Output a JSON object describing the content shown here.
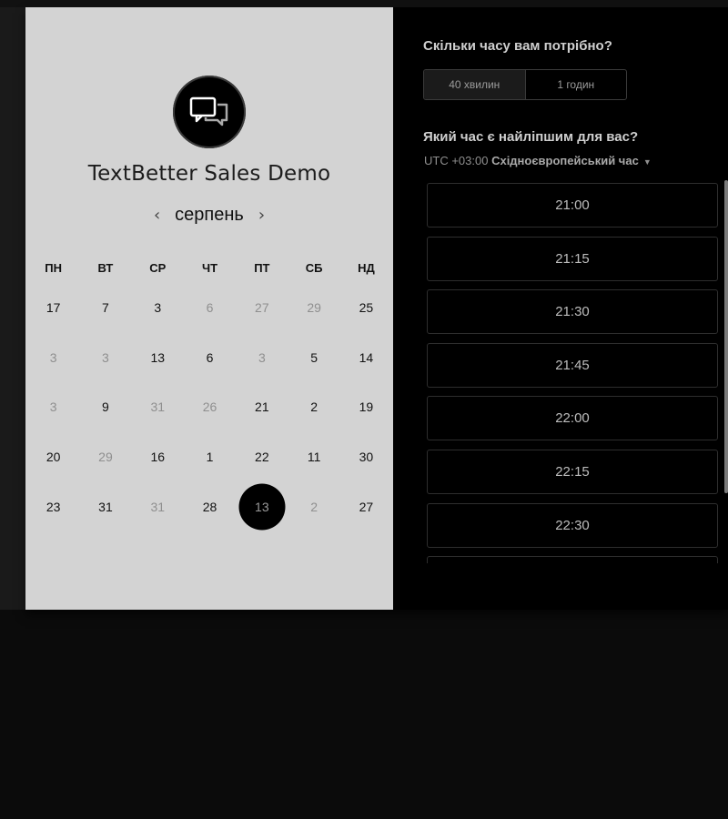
{
  "booking": {
    "org_title": "TextBetter Sales Demo",
    "logo_icon": "chat-bubbles-icon",
    "month": "серпень",
    "prev_icon": "chevron-left-icon",
    "next_icon": "chevron-right-icon",
    "weekdays": [
      "ПН",
      "ВТ",
      "СР",
      "ЧТ",
      "ПТ",
      "СБ",
      "НД"
    ],
    "days": [
      {
        "label": "17",
        "muted": false
      },
      {
        "label": "7",
        "muted": false
      },
      {
        "label": "3",
        "muted": false
      },
      {
        "label": "6",
        "muted": true
      },
      {
        "label": "27",
        "muted": true
      },
      {
        "label": "29",
        "muted": true
      },
      {
        "label": "25",
        "muted": false
      },
      {
        "label": "3",
        "muted": true
      },
      {
        "label": "3",
        "muted": true
      },
      {
        "label": "13",
        "muted": false
      },
      {
        "label": "6",
        "muted": false
      },
      {
        "label": "3",
        "muted": true
      },
      {
        "label": "5",
        "muted": false
      },
      {
        "label": "14",
        "muted": false
      },
      {
        "label": "3",
        "muted": true
      },
      {
        "label": "9",
        "muted": false
      },
      {
        "label": "31",
        "muted": true
      },
      {
        "label": "26",
        "muted": true
      },
      {
        "label": "21",
        "muted": false
      },
      {
        "label": "2",
        "muted": false
      },
      {
        "label": "19",
        "muted": false
      },
      {
        "label": "20",
        "muted": false
      },
      {
        "label": "29",
        "muted": true
      },
      {
        "label": "16",
        "muted": false
      },
      {
        "label": "1",
        "muted": false
      },
      {
        "label": "22",
        "muted": false
      },
      {
        "label": "11",
        "muted": false
      },
      {
        "label": "30",
        "muted": false
      },
      {
        "label": "23",
        "muted": false
      },
      {
        "label": "31",
        "muted": false
      },
      {
        "label": "31",
        "muted": true
      },
      {
        "label": "28",
        "muted": false
      },
      {
        "label": "13",
        "muted": false,
        "selected": true
      },
      {
        "label": "2",
        "muted": true
      },
      {
        "label": "27",
        "muted": false
      }
    ]
  },
  "duration": {
    "question": "Скільки часу вам потрібно?",
    "options": [
      {
        "label": "40 хвилин",
        "active": true
      },
      {
        "label": "1 годин",
        "active": false
      }
    ]
  },
  "times": {
    "question": "Який час є найліпшим для вас?",
    "tz_offset": "UTC +03:00",
    "tz_name": "Східноєвропейський час",
    "tz_caret_icon": "caret-down-icon",
    "slots": [
      "21:00",
      "21:15",
      "21:30",
      "21:45",
      "22:00",
      "22:15",
      "22:30",
      ""
    ]
  },
  "colors": {
    "left_bg": "#d3d3d3",
    "right_bg": "#000000",
    "selected_day": "#000000"
  }
}
